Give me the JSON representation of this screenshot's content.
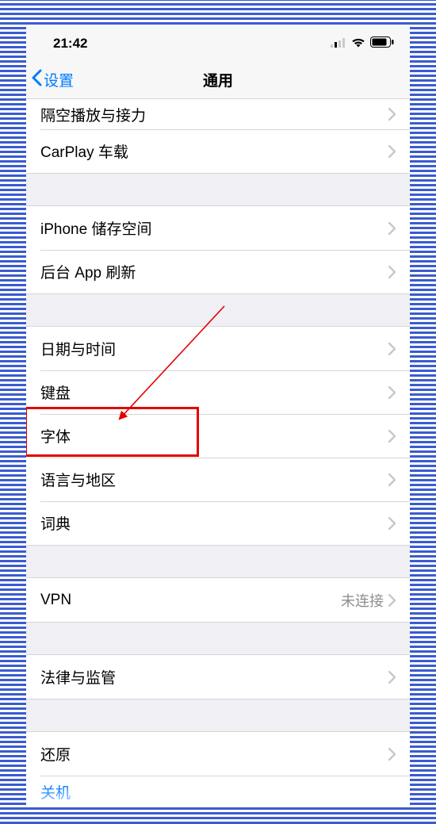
{
  "statusbar": {
    "time": "21:42"
  },
  "nav": {
    "back_label": "设置",
    "title": "通用"
  },
  "group0": {
    "row0": "隔空播放与接力",
    "row1": "CarPlay 车载"
  },
  "group1": {
    "row0": "iPhone 储存空间",
    "row1": "后台 App 刷新"
  },
  "group2": {
    "row0": "日期与时间",
    "row1": "键盘",
    "row2": "字体",
    "row3": "语言与地区",
    "row4": "词典"
  },
  "group3": {
    "row0": "VPN",
    "row0_detail": "未连接"
  },
  "group4": {
    "row0": "法律与监管"
  },
  "group5": {
    "row0": "还原",
    "row1": "关机"
  }
}
